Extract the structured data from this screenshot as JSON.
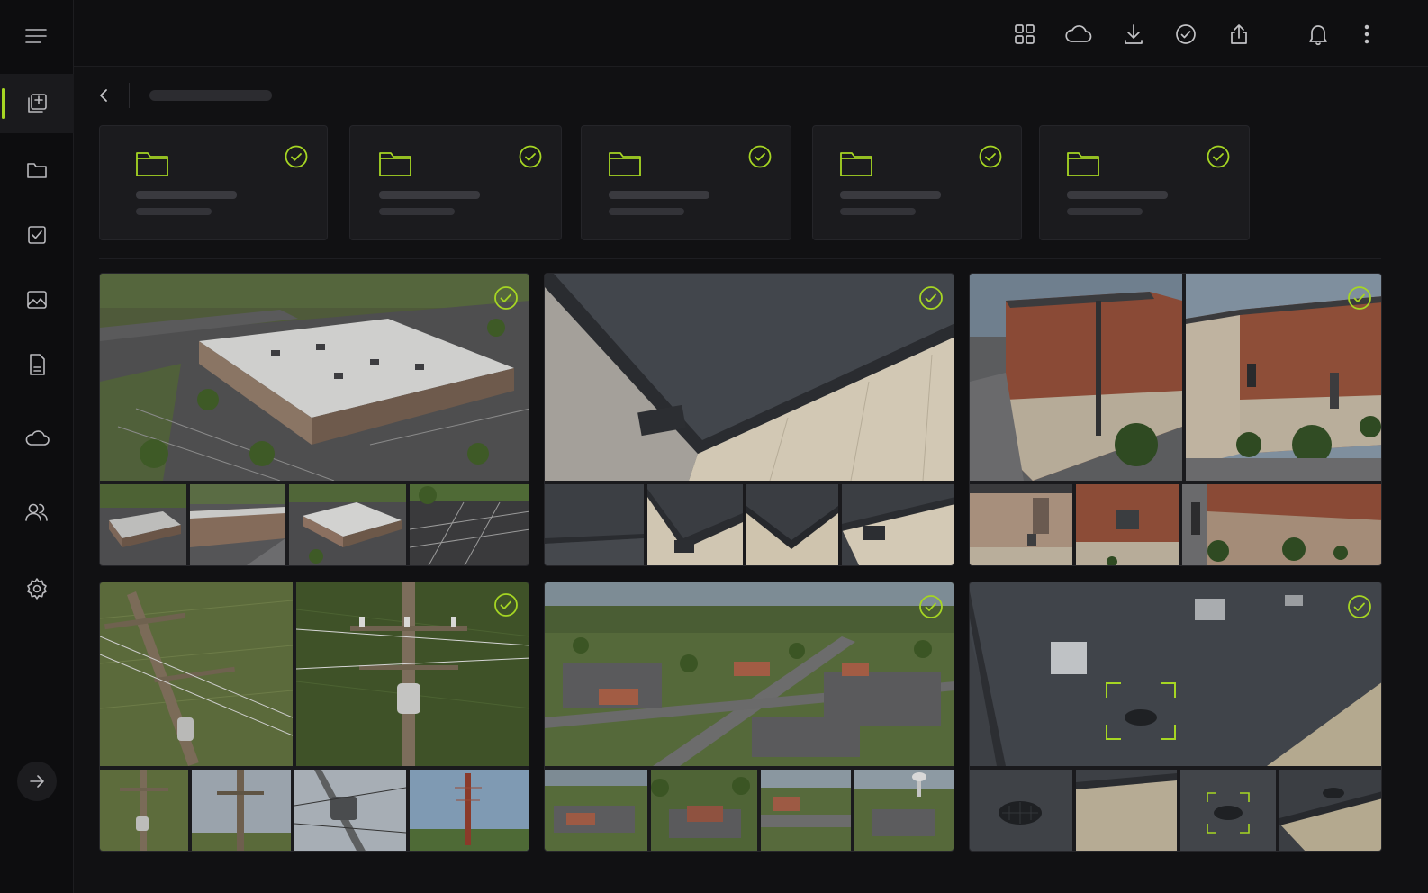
{
  "colors": {
    "accent": "#a6d623",
    "background": "#111113",
    "sidebar": "#0d0d0f",
    "card": "#1b1b1e"
  },
  "sidebar": {
    "menu_icon": "hamburger-icon",
    "items": [
      {
        "icon": "gallery-icon",
        "active": true
      },
      {
        "icon": "folder-icon",
        "active": false
      },
      {
        "icon": "checkbox-icon",
        "active": false
      },
      {
        "icon": "image-icon",
        "active": false
      },
      {
        "icon": "document-icon",
        "active": false
      },
      {
        "icon": "cloud-icon",
        "active": false
      },
      {
        "icon": "users-icon",
        "active": false
      },
      {
        "icon": "gear-icon",
        "active": false
      }
    ],
    "expand_icon": "arrow-right-icon"
  },
  "topbar": {
    "icons": [
      "grid-icon",
      "cloud-icon",
      "download-icon",
      "check-circle-icon",
      "share-icon",
      "bell-icon",
      "more-vertical-icon"
    ]
  },
  "breadcrumb": {
    "back_icon": "chevron-left-icon"
  },
  "folders": [
    {
      "icon": "folder-icon",
      "status_icon": "check-circle-icon",
      "checked": true
    },
    {
      "icon": "folder-icon",
      "status_icon": "check-circle-icon",
      "checked": true
    },
    {
      "icon": "folder-icon",
      "status_icon": "check-circle-icon",
      "checked": true
    },
    {
      "icon": "folder-icon",
      "status_icon": "check-circle-icon",
      "checked": true
    },
    {
      "icon": "folder-icon",
      "status_icon": "check-circle-icon",
      "checked": true
    }
  ],
  "photo_groups": [
    {
      "subject": "aerial-warehouse",
      "checked": true,
      "thumbnails": 4
    },
    {
      "subject": "roof-edge-flashing",
      "checked": true,
      "thumbnails": 4
    },
    {
      "subject": "brick-building-walls",
      "checked": true,
      "thumbnails": 3
    },
    {
      "subject": "utility-poles",
      "checked": true,
      "thumbnails": 4
    },
    {
      "subject": "aerial-town",
      "checked": true,
      "thumbnails": 4
    },
    {
      "subject": "flat-roof-drain",
      "checked": true,
      "thumbnails": 4
    }
  ]
}
